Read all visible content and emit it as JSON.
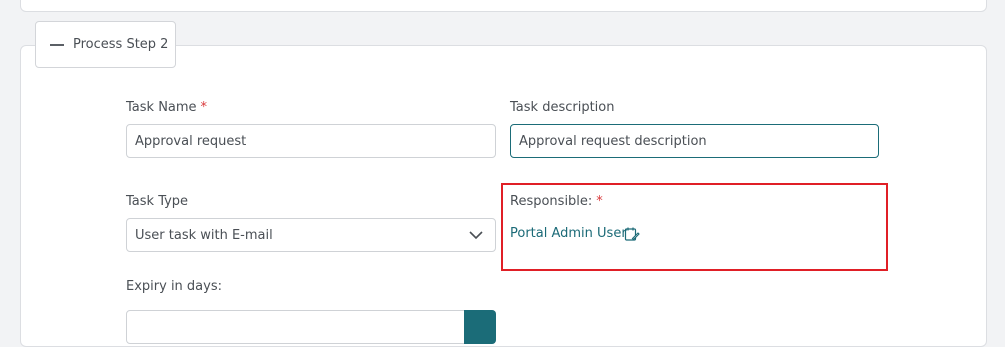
{
  "process_step": {
    "title": "Process Step 2",
    "collapse_icon": "minus-icon"
  },
  "form": {
    "task_name": {
      "label": "Task Name",
      "required_mark": "*",
      "value": "Approval request"
    },
    "task_description": {
      "label": "Task description",
      "value": "Approval request description"
    },
    "task_type": {
      "label": "Task Type",
      "selected": "User task with E-mail",
      "icon": "chevron-down-icon"
    },
    "responsible": {
      "label": "Responsible:",
      "required_mark": "*",
      "value": "Portal Admin User",
      "icon": "edit-note-icon"
    },
    "expiry": {
      "label": "Expiry in days:"
    }
  },
  "colors": {
    "accent": "#1b6c78",
    "required": "#d9383a",
    "highlight": "#e01f26"
  }
}
